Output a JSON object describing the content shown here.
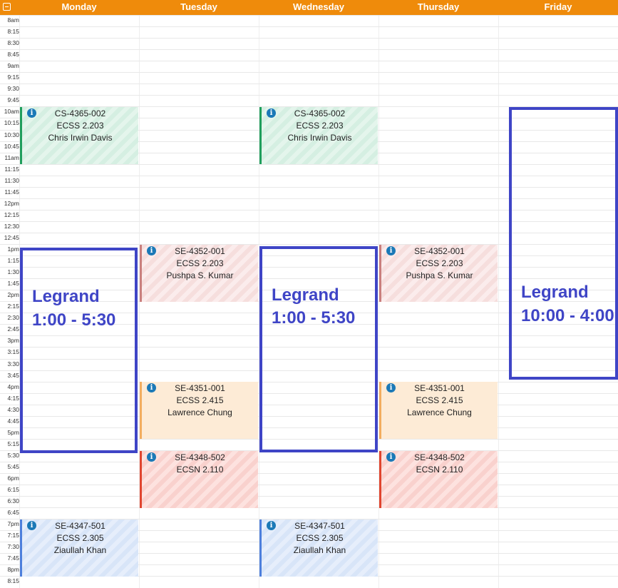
{
  "header": {
    "collapse_icon": "minus-square-icon",
    "days": [
      "Monday",
      "Tuesday",
      "Wednesday",
      "Thursday",
      "Friday"
    ],
    "color": "#ef8b0b"
  },
  "times": [
    "8am",
    "8:15",
    "8:30",
    "8:45",
    "9am",
    "9:15",
    "9:30",
    "9:45",
    "10am",
    "10:15",
    "10:30",
    "10:45",
    "11am",
    "11:15",
    "11:30",
    "11:45",
    "12pm",
    "12:15",
    "12:30",
    "12:45",
    "1pm",
    "1:15",
    "1:30",
    "1:45",
    "2pm",
    "2:15",
    "2:30",
    "2:45",
    "3pm",
    "3:15",
    "3:30",
    "3:45",
    "4pm",
    "4:15",
    "4:30",
    "4:45",
    "5pm",
    "5:15",
    "5:30",
    "5:45",
    "6pm",
    "6:15",
    "6:30",
    "6:45",
    "7pm",
    "7:15",
    "7:30",
    "7:45",
    "8pm",
    "8:15"
  ],
  "events": {
    "mon_cs": {
      "line1": "CS-4365-002",
      "line2": "ECSS 2.203",
      "line3": "Chris Irwin Davis"
    },
    "wed_cs": {
      "line1": "CS-4365-002",
      "line2": "ECSS 2.203",
      "line3": "Chris Irwin Davis"
    },
    "tue_se4352": {
      "line1": "SE-4352-001",
      "line2": "ECSS 2.203",
      "line3": "Pushpa S. Kumar"
    },
    "thu_se4352": {
      "line1": "SE-4352-001",
      "line2": "ECSS 2.203",
      "line3": "Pushpa S. Kumar"
    },
    "tue_se4351": {
      "line1": "SE-4351-001",
      "line2": "ECSS 2.415",
      "line3": "Lawrence Chung"
    },
    "thu_se4351": {
      "line1": "SE-4351-001",
      "line2": "ECSS 2.415",
      "line3": "Lawrence Chung"
    },
    "tue_se4348": {
      "line1": "SE-4348-502",
      "line2": "ECSN 2.110"
    },
    "thu_se4348": {
      "line1": "SE-4348-502",
      "line2": "ECSN 2.110"
    },
    "mon_se4347": {
      "line1": "SE-4347-501",
      "line2": "ECSS 2.305",
      "line3": "Ziaullah Khan"
    },
    "wed_se4347": {
      "line1": "SE-4347-501",
      "line2": "ECSS 2.305",
      "line3": "Ziaullah Khan"
    }
  },
  "info_glyph": "i",
  "annotations": {
    "monday": {
      "title": "Legrand",
      "hours": "1:00 - 5:30"
    },
    "wednesday": {
      "title": "Legrand",
      "hours": "1:00 - 5:30"
    },
    "friday": {
      "title": "Legrand",
      "hours": "10:00 - 4:00"
    }
  },
  "colors": {
    "annotation": "#3f45c6",
    "green": "#1f9e5c",
    "pink": "#c97f7d",
    "peach": "#f2ad5f",
    "red": "#e0452f",
    "blue": "#4d7fdc",
    "info": "#1b79b7"
  }
}
